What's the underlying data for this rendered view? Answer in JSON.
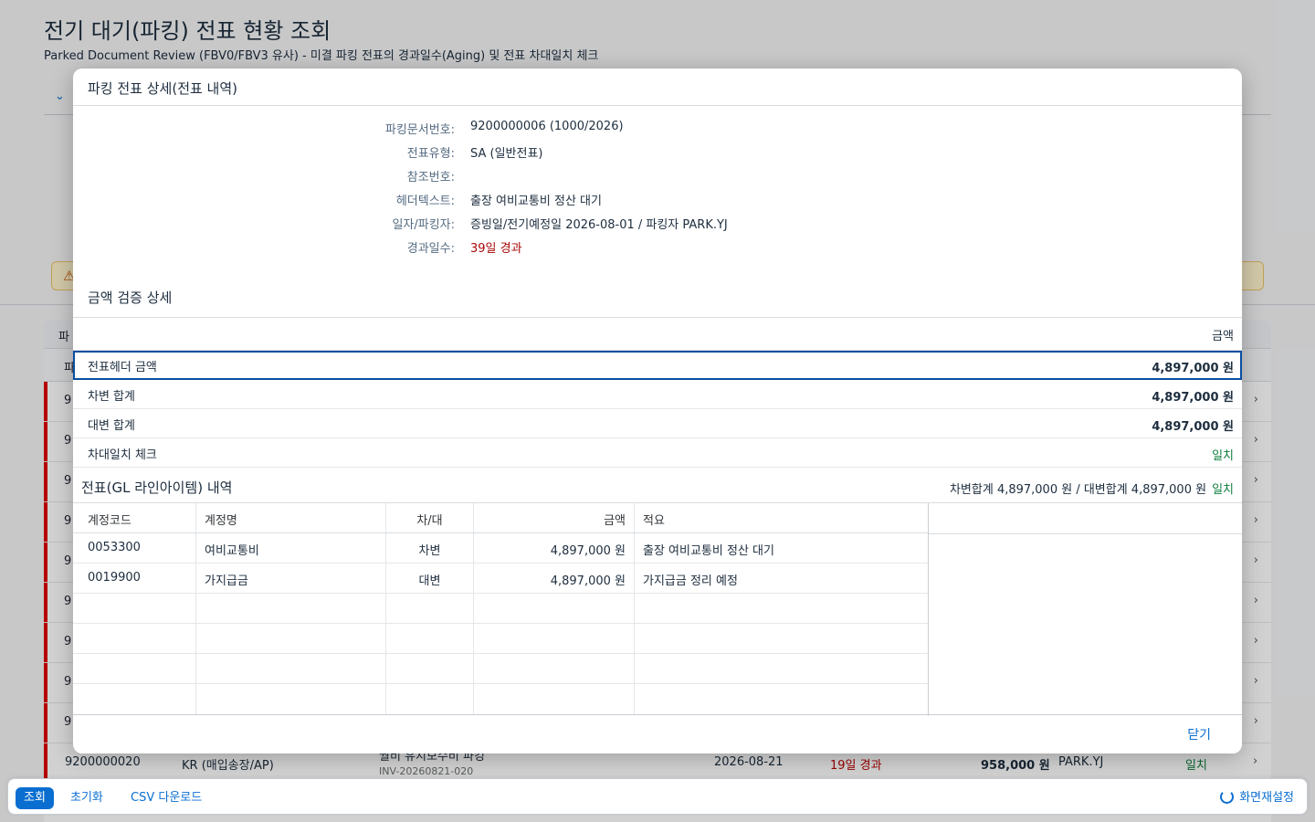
{
  "page": {
    "title": "전기 대기(파킹) 전표 현황 조회",
    "subtitle": "Parked Document Review (FBV0/FBV3 유사) - 미결 파킹 전표의 경과일수(Aging) 및 전표 차대일치 체크"
  },
  "background_table": {
    "header_fragment": "파",
    "subheader_fragment": "파",
    "row_fragments": [
      "9",
      "9",
      "9",
      "9",
      "9",
      "9",
      "9",
      "9",
      "9"
    ],
    "visible_row": {
      "doc_no": "9200000020",
      "doc_type": "KR (매입송장/AP)",
      "header_text": "월비 유지보수비 파킹",
      "reference": "INV-20260821-020",
      "date": "2026-08-21",
      "aging": "19일 경과",
      "amount": "958,000 원",
      "parker": "PARK.YJ",
      "balance": "일치"
    }
  },
  "dialog": {
    "title": "파킹 전표 상세(전표 내역)",
    "fields": [
      {
        "label": "파킹문서번호:",
        "value": "9200000006 (1000/2026)",
        "emphasis": "normal"
      },
      {
        "label": "전표유형:",
        "value": "SA (일반전표)",
        "emphasis": "normal"
      },
      {
        "label": "참조번호:",
        "value": "",
        "emphasis": "normal"
      },
      {
        "label": "헤더텍스트:",
        "value": "출장 여비교통비 정산 대기",
        "emphasis": "normal"
      },
      {
        "label": "일자/파킹자:",
        "value": "증빙일/전기예정일 2026-08-01 / 파킹자 PARK.YJ",
        "emphasis": "normal"
      },
      {
        "label": "경과일수:",
        "value": "39일 경과",
        "emphasis": "red"
      }
    ],
    "amount_section": {
      "title": "금액 검증 상세",
      "column_header": "금액",
      "rows": [
        {
          "label": "전표헤더 금액",
          "value": "4,897,000 원"
        },
        {
          "label": "차변 합계",
          "value": "4,897,000 원"
        },
        {
          "label": "대변 합계",
          "value": "4,897,000 원"
        },
        {
          "label": "차대일치 체크",
          "value": "일치"
        }
      ]
    },
    "gl_section": {
      "title": "전표(GL 라인아이템) 내역",
      "summary": "차변합계 4,897,000 원 / 대변합계 4,897,000 원",
      "summary_status": "일치",
      "columns": [
        "계정코드",
        "계정명",
        "차/대",
        "금액",
        "적요"
      ],
      "rows": [
        [
          "0053300",
          "여비교통비",
          "차변",
          "4,897,000 원",
          "출장 여비교통비 정산 대기"
        ],
        [
          "0019900",
          "가지급금",
          "대변",
          "4,897,000 원",
          "가지급금 정리 예정"
        ]
      ]
    },
    "close_label": "닫기"
  },
  "footer": {
    "search_label": "조회",
    "reset_label": "초기화",
    "csv_label": "CSV 다운로드",
    "settings_label": "화면재설정"
  },
  "colors": {
    "accent": "#0a6ed1",
    "danger": "#aa0808",
    "success": "#107e3e"
  }
}
